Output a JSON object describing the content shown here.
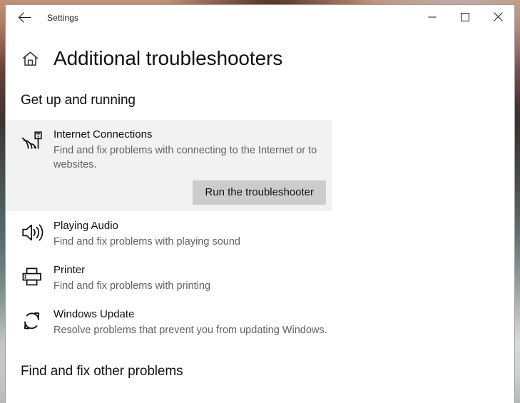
{
  "window": {
    "app_title": "Settings",
    "back_icon": "back-arrow-icon",
    "minimize_icon": "minimize-icon",
    "maximize_icon": "maximize-icon",
    "close_icon": "close-icon"
  },
  "page": {
    "home_icon": "home-icon",
    "title": "Additional troubleshooters"
  },
  "sections": [
    {
      "heading": "Get up and running",
      "items": [
        {
          "icon": "internet-connections-icon",
          "name": "Internet Connections",
          "desc": "Find and fix problems with connecting to the Internet or to websites.",
          "selected": true,
          "action_label": "Run the troubleshooter"
        },
        {
          "icon": "playing-audio-icon",
          "name": "Playing Audio",
          "desc": "Find and fix problems with playing sound",
          "selected": false
        },
        {
          "icon": "printer-icon",
          "name": "Printer",
          "desc": "Find and fix problems with printing",
          "selected": false
        },
        {
          "icon": "windows-update-icon",
          "name": "Windows Update",
          "desc": "Resolve problems that prevent you from updating Windows.",
          "selected": false
        }
      ]
    },
    {
      "heading": "Find and fix other problems",
      "items": []
    }
  ],
  "colors": {
    "card_background": "#f2f2f2",
    "button_background": "#cccccc",
    "primary_text": "#101010",
    "secondary_text": "#616161",
    "window_background": "#ffffff"
  }
}
